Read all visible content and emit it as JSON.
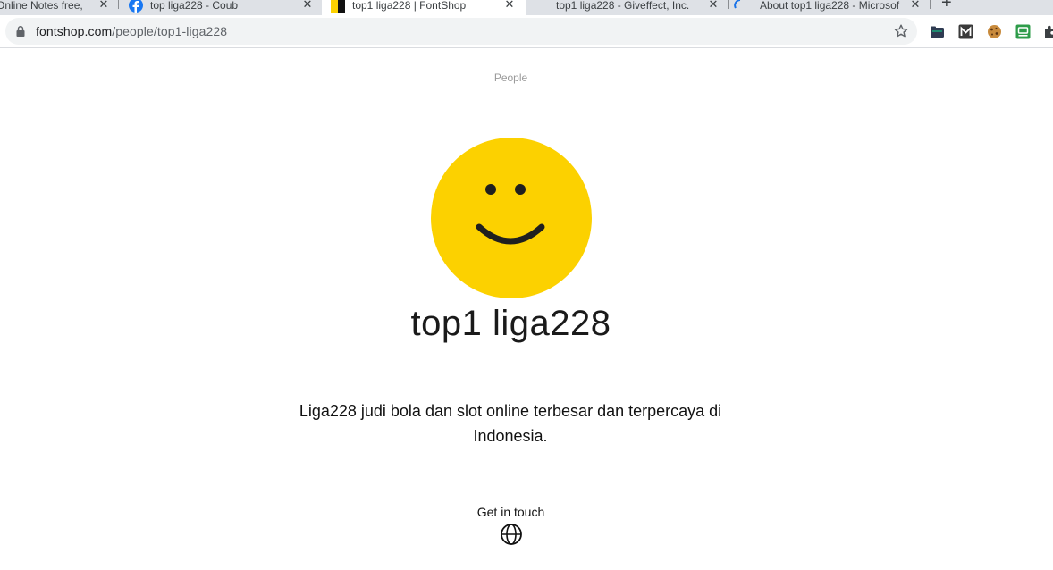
{
  "browser": {
    "tabs": [
      {
        "title": "Online Notes free, n",
        "close": "✕"
      },
      {
        "title": "top liga228 - Coub",
        "close": "✕"
      },
      {
        "title": "top1 liga228 | FontShop",
        "close": "✕"
      },
      {
        "title": "top1 liga228 - Giveffect, Inc.",
        "close": "✕"
      },
      {
        "title": "About top1 liga228 - Microsof",
        "close": "✕"
      }
    ],
    "new_tab": "+",
    "url_host": "fontshop.com",
    "url_path": "/people/top1-liga228"
  },
  "page": {
    "breadcrumb": "People",
    "name": "top1 liga228",
    "bio": "Liga228 judi bola dan slot online terbesar dan terpercaya di Indonesia.",
    "contact_label": "Get in touch",
    "avatar_color": "#FCD100",
    "icons": {
      "avatar": "smiley-avatar",
      "contact": "globe-icon"
    }
  }
}
